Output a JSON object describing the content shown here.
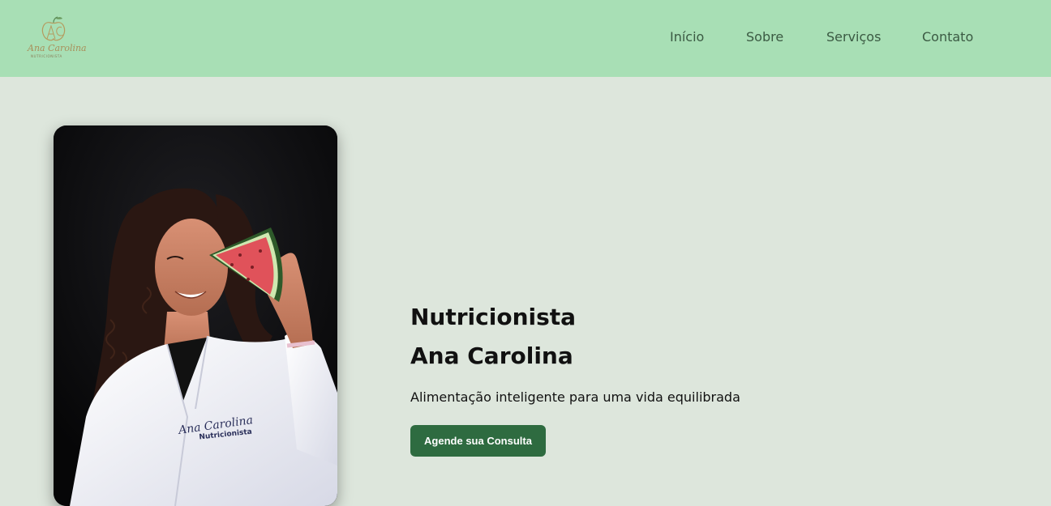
{
  "header": {
    "logo": {
      "name": "Ana Carolina",
      "subtitle": "NUTRICIONISTA"
    },
    "nav": [
      {
        "label": "Início"
      },
      {
        "label": "Sobre"
      },
      {
        "label": "Serviços"
      },
      {
        "label": "Contato"
      }
    ]
  },
  "hero": {
    "photo": {
      "coat_name": "Ana Carolina",
      "coat_title": "Nutricionista"
    },
    "title_line1": "Nutricionista",
    "title_line2": "Ana Carolina",
    "subtitle": "Alimentação inteligente para uma vida equilibrada",
    "cta_label": "Agende sua Consulta"
  },
  "colors": {
    "header_bg": "#a8dfb5",
    "page_bg": "#dde6dc",
    "nav_text": "#3b5a43",
    "cta_bg": "#2e6b40",
    "cta_text": "#ffffff"
  }
}
